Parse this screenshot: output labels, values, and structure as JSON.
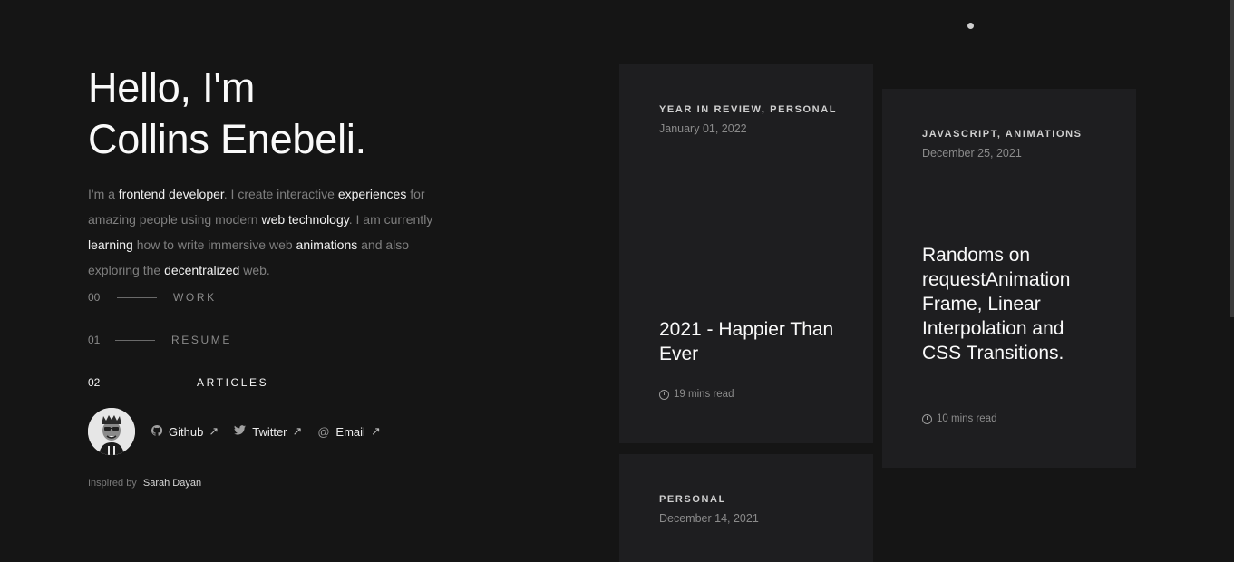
{
  "hero": {
    "line1": "Hello, I'm",
    "line2": "Collins Enebeli."
  },
  "bio": [
    {
      "t": "I'm a ",
      "hl": false
    },
    {
      "t": "frontend developer",
      "hl": true
    },
    {
      "t": ". I create interactive ",
      "hl": false
    },
    {
      "t": "experiences",
      "hl": true
    },
    {
      "t": " for amazing people using modern ",
      "hl": false
    },
    {
      "t": "web technology",
      "hl": true
    },
    {
      "t": ". I am currently ",
      "hl": false
    },
    {
      "t": "learning",
      "hl": true
    },
    {
      "t": " how to write immersive web ",
      "hl": false
    },
    {
      "t": "animations",
      "hl": true
    },
    {
      "t": " and also exploring the ",
      "hl": false
    },
    {
      "t": "decentralized",
      "hl": true
    },
    {
      "t": " web.",
      "hl": false
    }
  ],
  "nav": [
    {
      "num": "00",
      "label": "WORK",
      "active": false
    },
    {
      "num": "01",
      "label": "RESUME",
      "active": false
    },
    {
      "num": "02",
      "label": "ARTICLES",
      "active": true
    }
  ],
  "social": [
    {
      "icon": "github-icon",
      "label": "Github"
    },
    {
      "icon": "twitter-icon",
      "label": "Twitter"
    },
    {
      "icon": "email-icon",
      "label": "Email"
    }
  ],
  "credit": {
    "prefix": "Inspired by",
    "name": "Sarah Dayan"
  },
  "articles": [
    {
      "tags": "YEAR IN REVIEW, PERSONAL",
      "date": "January 01, 2022",
      "title": "2021 - Happier Than Ever",
      "read": "19 mins read"
    },
    {
      "tags": "JAVASCRIPT, ANIMATIONS",
      "date": "December 25, 2021",
      "title": "Randoms on requestAnimation Frame, Linear Interpolation and CSS Transitions.",
      "read": "10 mins read"
    },
    {
      "tags": "PERSONAL",
      "date": "December 14, 2021",
      "title": "",
      "read": ""
    }
  ],
  "colors": {
    "background": "#151515",
    "card": "#1e1e20",
    "text": "#fafafa",
    "muted": "#7f7f7f"
  }
}
